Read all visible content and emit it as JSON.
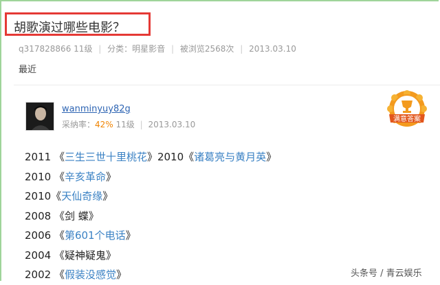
{
  "question": {
    "title": "胡歌演过哪些电影？",
    "asker": "q317828866",
    "level": "11级",
    "category": "分类：明星影音",
    "views": "被浏览2568次",
    "date": "2013.03.10",
    "body": "最近"
  },
  "answer": {
    "username": "wanminyuy82g",
    "adoption_label": "采纳率：",
    "adoption_rate": "42%",
    "level": "11级",
    "date": "2013.03.10",
    "badge_text": "满意答案",
    "lines": [
      {
        "segs": [
          {
            "t": "2011 《",
            "link": false
          },
          {
            "t": "三生三世十里桃花",
            "link": true
          },
          {
            "t": "》2010《",
            "link": false
          },
          {
            "t": "诸葛亮与黄月英",
            "link": true
          },
          {
            "t": "》",
            "link": false
          }
        ]
      },
      {
        "segs": [
          {
            "t": "2010 《",
            "link": false
          },
          {
            "t": "辛亥革命",
            "link": true
          },
          {
            "t": "》",
            "link": false
          }
        ]
      },
      {
        "segs": [
          {
            "t": "2010《",
            "link": false
          },
          {
            "t": "天仙奇缘",
            "link": true
          },
          {
            "t": "》",
            "link": false
          }
        ]
      },
      {
        "segs": [
          {
            "t": "2008 《剑 蝶》",
            "link": false
          }
        ]
      },
      {
        "segs": [
          {
            "t": "2006 《",
            "link": false
          },
          {
            "t": "第601个电话",
            "link": true
          },
          {
            "t": "》",
            "link": false
          }
        ]
      },
      {
        "segs": [
          {
            "t": "2004 《疑神疑鬼》",
            "link": false
          }
        ]
      },
      {
        "segs": [
          {
            "t": "2002 《",
            "link": false
          },
          {
            "t": "假装没感觉",
            "link": true
          },
          {
            "t": "》",
            "link": false
          }
        ]
      }
    ]
  },
  "watermark": "头条号 / 青云娱乐",
  "colors": {
    "title_highlight": "#e53935",
    "link": "#3b82c4",
    "rate": "#f08300",
    "frame": "#9fd49a"
  }
}
